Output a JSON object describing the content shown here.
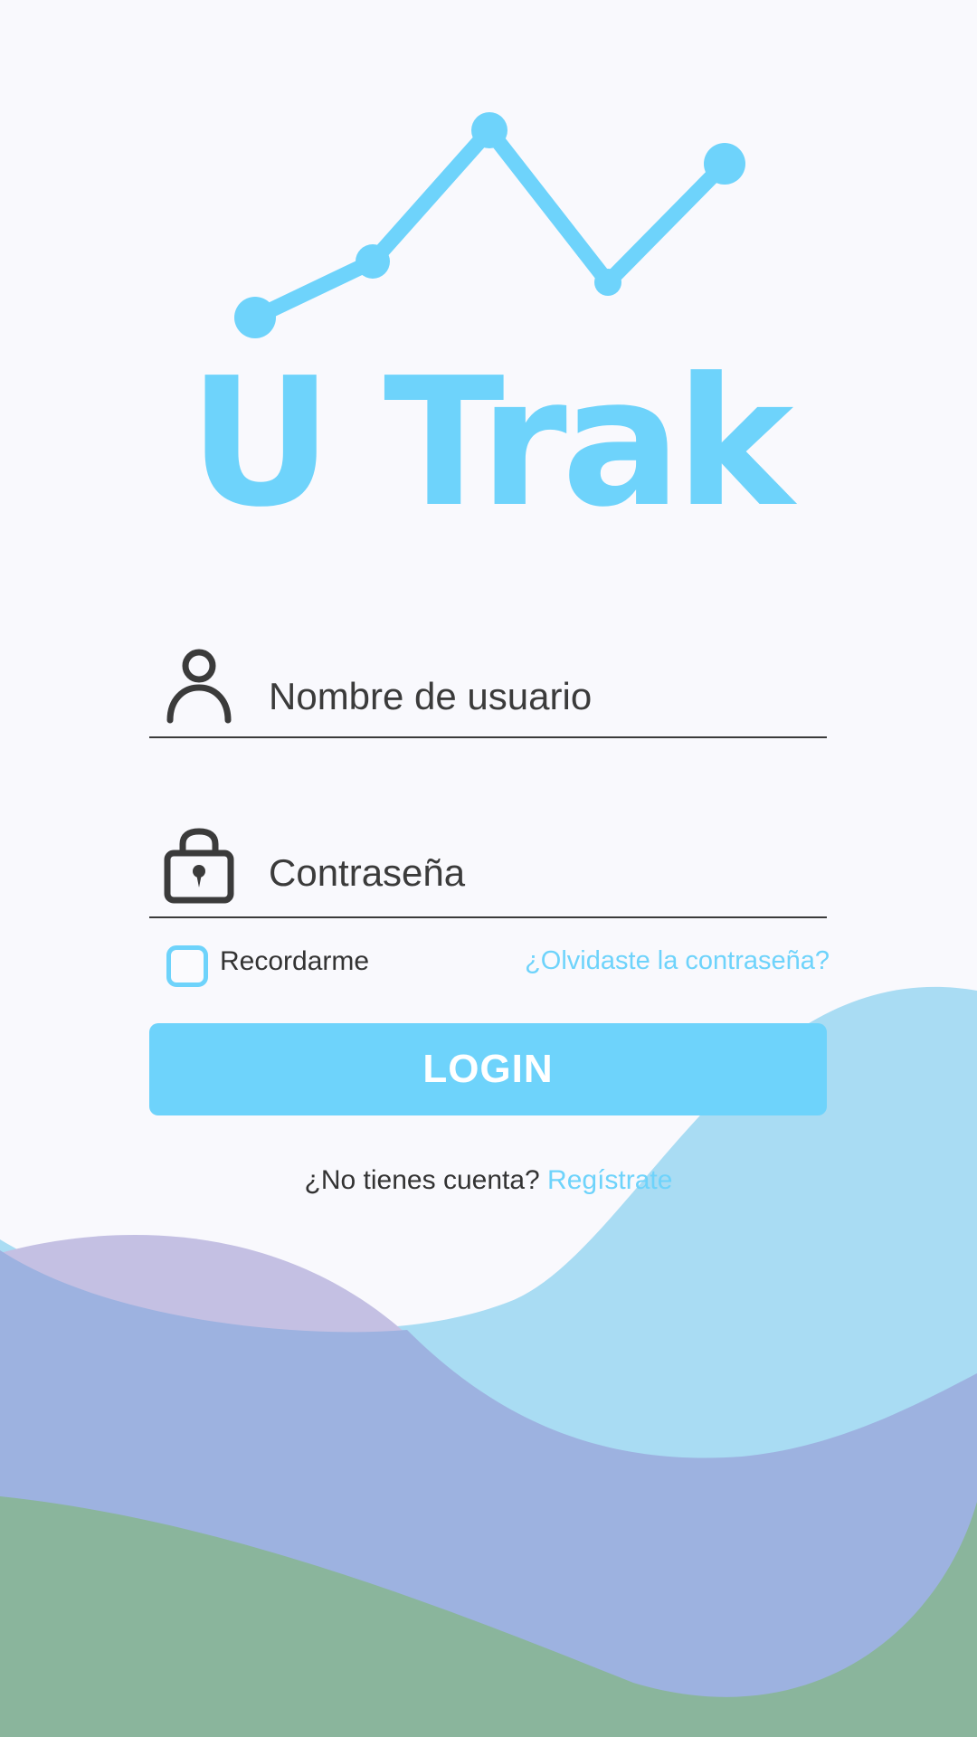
{
  "app": {
    "logo_text": "U Trak"
  },
  "form": {
    "username_placeholder": "Nombre de usuario",
    "username_value": "",
    "password_placeholder": "Contraseña",
    "password_value": "",
    "remember_label": "Recordarme",
    "remember_checked": false,
    "forgot_label": "¿Olvidaste la contraseña?",
    "login_label": "LOGIN"
  },
  "signup": {
    "prompt": "¿No tienes cuenta?",
    "link_label": "Regístrate"
  },
  "icons": {
    "username": "user-icon",
    "password": "padlock-icon"
  },
  "colors": {
    "accent": "#6ed3fb",
    "text": "#333333",
    "background": "#f9f9fd",
    "wave_light_blue": "#a9dcf3",
    "wave_lavender": "#c4c0e3",
    "wave_periwinkle": "#9db2e0",
    "wave_green": "#8ab59c"
  }
}
